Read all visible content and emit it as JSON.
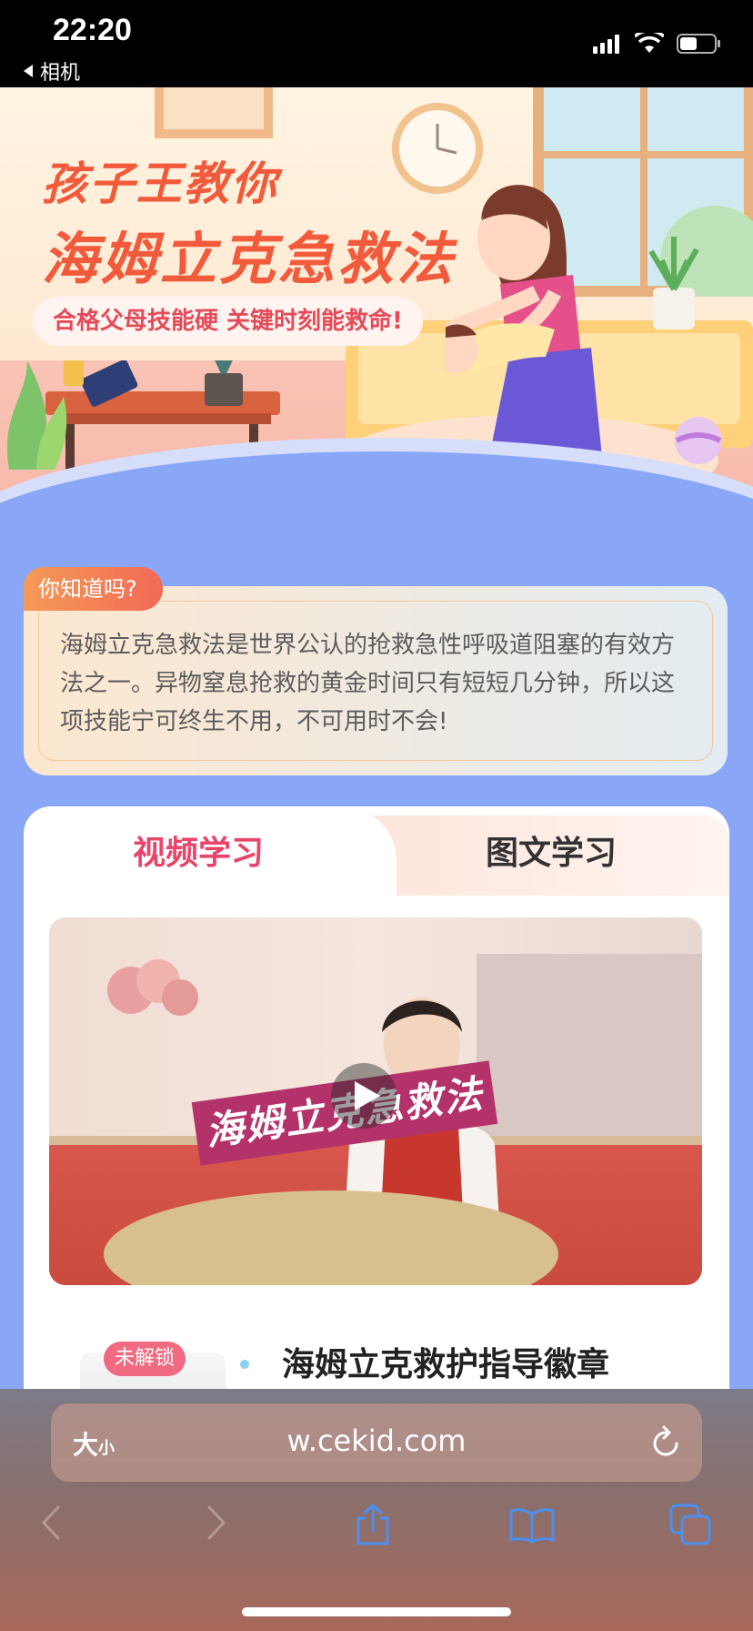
{
  "status_bar": {
    "time": "22:20",
    "back_app": "相机"
  },
  "hero": {
    "title_line1": "孩子王教你",
    "title_line2": "海姆立克急救法",
    "subtitle": "合格父母技能硬 关键时刻能救命!"
  },
  "info": {
    "tag": "你知道吗?",
    "text": "海姆立克急救法是世界公认的抢救急性呼吸道阻塞的有效方法之一。异物窒息抢救的黄金时间只有短短几分钟，所以这项技能宁可终生不用，不可用时不会!"
  },
  "tabs": {
    "video": "视频学习",
    "image": "图文学习"
  },
  "video": {
    "overlay_title": "海姆立克急救法"
  },
  "badge": {
    "status": "未解锁",
    "title": "海姆立克救护指导徽章"
  },
  "browser": {
    "text_size_label": "大",
    "text_size_small": "小",
    "url": "w.cekid.com"
  },
  "colors": {
    "accent": "#e9446a",
    "hero_title": "#f25a3c",
    "page_bg": "#8aa6f7"
  },
  "icons": [
    "back-arrow-icon",
    "signal-icon",
    "wifi-icon",
    "battery-icon",
    "play-icon",
    "reload-icon",
    "nav-back-icon",
    "nav-forward-icon",
    "share-icon",
    "bookmarks-icon",
    "tabs-icon"
  ]
}
